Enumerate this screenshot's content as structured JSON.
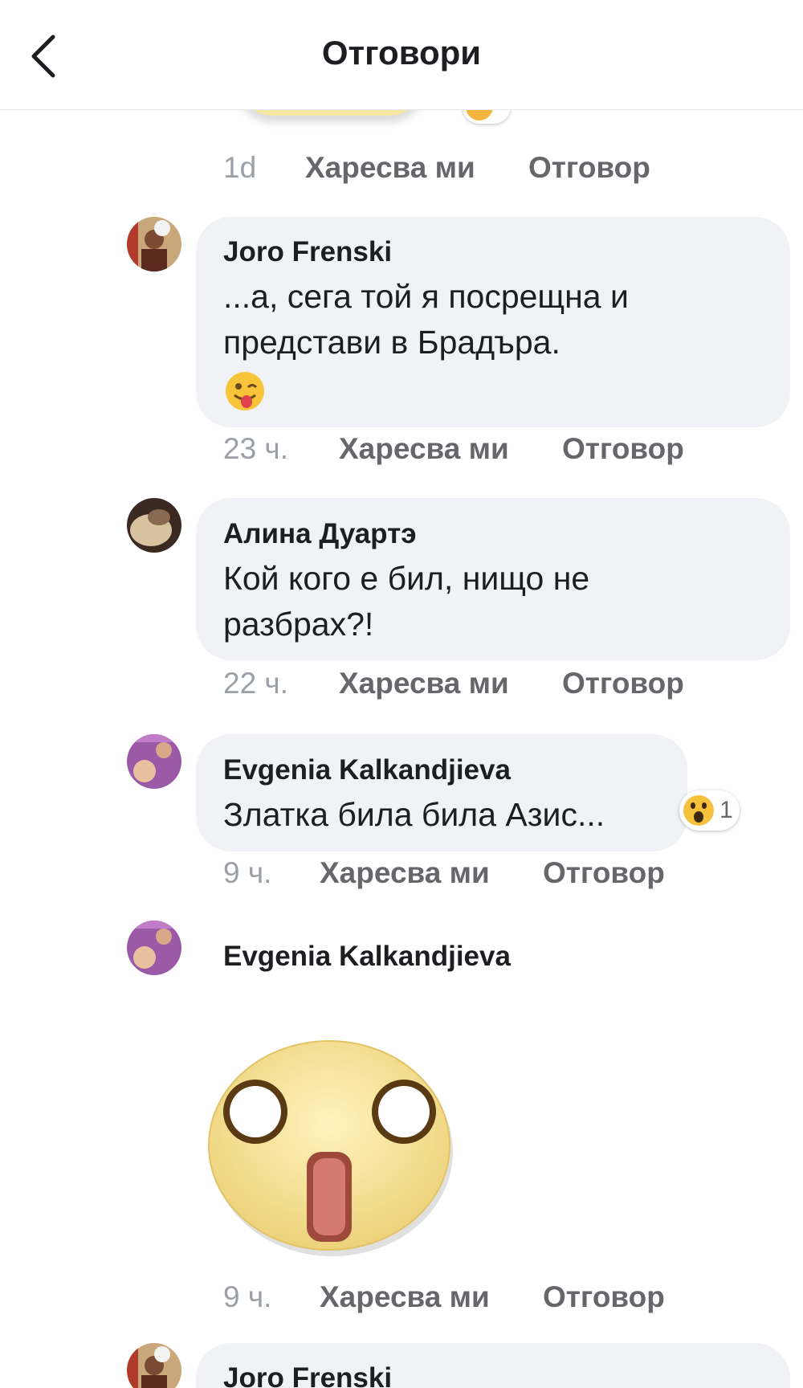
{
  "header": {
    "title": "Отговори"
  },
  "top_meta": {
    "time": "1d",
    "like": "Харесва ми",
    "reply": "Отговор"
  },
  "comments": [
    {
      "author": "Joro Frenski",
      "text": "...а, сега той я посрещна и представи в Брадъра.",
      "emoji": "winking-tongue-emoji",
      "time": "23 ч.",
      "like": "Харесва ми",
      "reply": "Отговор"
    },
    {
      "author": "Алина Дуартэ",
      "text": "Кой кого е бил, нищо не разбрах?!",
      "time": "22 ч.",
      "like": "Харесва ми",
      "reply": "Отговор"
    },
    {
      "author": "Evgenia Kalkandjieva",
      "text": "Златка била била Азис...",
      "reaction": {
        "icon": "wow-reaction-icon",
        "count": "1"
      },
      "time": "9 ч.",
      "like": "Харесва ми",
      "reply": "Отговор"
    },
    {
      "author": "Evgenia Kalkandjieva",
      "sticker": "shocked-face-sticker",
      "time": "9 ч.",
      "like": "Харесва ми",
      "reply": "Отговор"
    },
    {
      "author": "Joro Frenski"
    }
  ]
}
